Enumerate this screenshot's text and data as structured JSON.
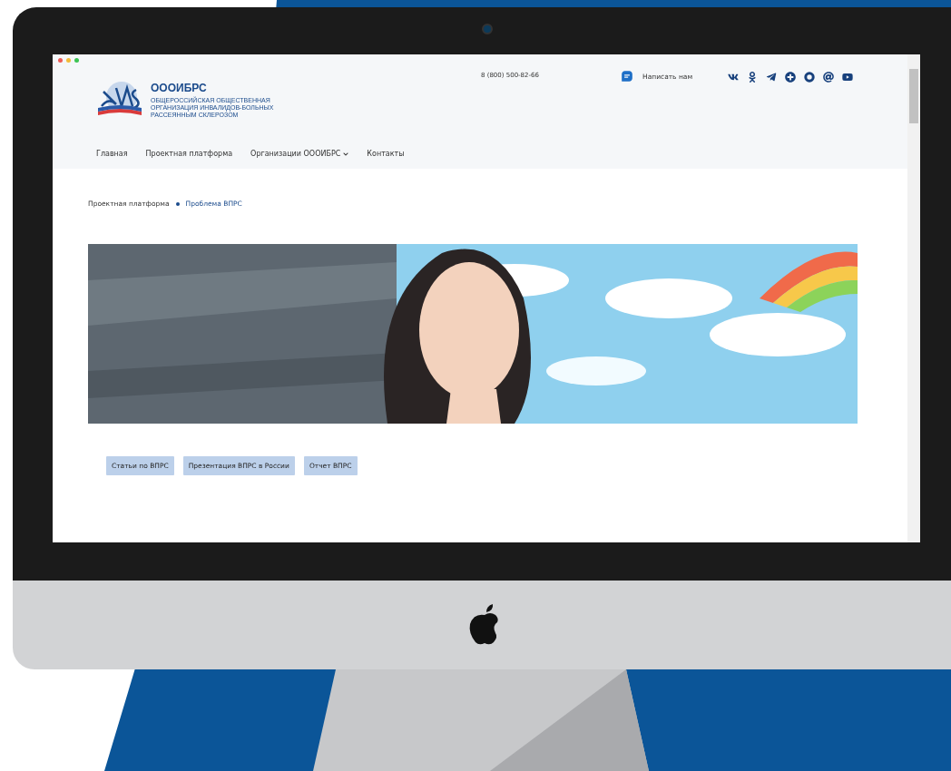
{
  "header": {
    "logo": {
      "title": "ОООИБРС",
      "subtitle": "ОБЩЕРОССИЙСКАЯ ОБЩЕСТВЕННАЯ ОРГАНИЗАЦИЯ ИНВАЛИДОВ-БОЛЬНЫХ РАССЕЯННЫМ СКЛЕРОЗОМ"
    },
    "phone": "8 (800) 500-82-66",
    "contact_link": "Написать нам",
    "nav": [
      {
        "label": "Главная",
        "has_dropdown": false
      },
      {
        "label": "Проектная платформа",
        "has_dropdown": false
      },
      {
        "label": "Организации ОООИБРС",
        "has_dropdown": true
      },
      {
        "label": "Контакты",
        "has_dropdown": false
      }
    ]
  },
  "breadcrumbs": [
    {
      "label": "Проектная платформа",
      "current": false
    },
    {
      "label": "Проблема ВПРС",
      "current": true
    }
  ],
  "banner": {
    "kind": "picture"
  },
  "buttons": [
    "Статьи по ВПРС",
    "Презентация ВПРС в России",
    "Отчет ВПРС"
  ]
}
